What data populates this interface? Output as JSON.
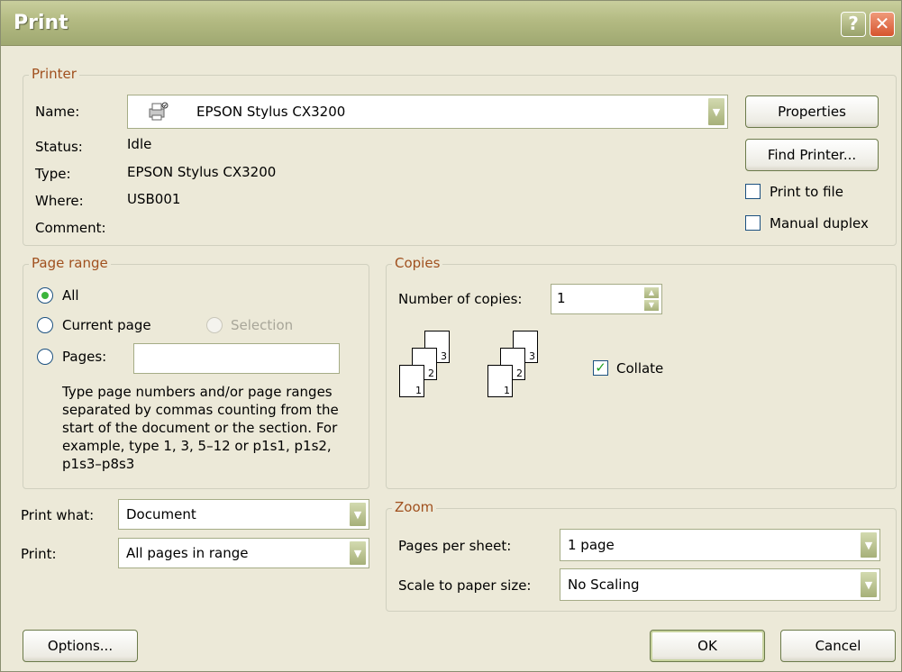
{
  "window": {
    "title": "Print"
  },
  "printer": {
    "group_label": "Printer",
    "name_label": "Name:",
    "name_value": "EPSON Stylus CX3200",
    "status_label": "Status:",
    "status_value": "Idle",
    "type_label": "Type:",
    "type_value": "EPSON Stylus CX3200",
    "where_label": "Where:",
    "where_value": "USB001",
    "comment_label": "Comment:",
    "comment_value": "",
    "properties_button": "Properties",
    "find_printer_button": "Find Printer...",
    "print_to_file_label": "Print to file",
    "print_to_file_checked": false,
    "manual_duplex_label": "Manual duplex",
    "manual_duplex_checked": false
  },
  "page_range": {
    "group_label": "Page range",
    "all_label": "All",
    "current_page_label": "Current page",
    "selection_label": "Selection",
    "pages_label": "Pages:",
    "pages_value": "",
    "selected": "All",
    "help_text": "Type page numbers and/or page ranges separated by commas counting from the start of the document or the section. For example, type 1, 3, 5–12 or p1s1, p1s2, p1s3–p8s3"
  },
  "copies": {
    "group_label": "Copies",
    "number_label": "Number of copies:",
    "number_value": "1",
    "collate_label": "Collate",
    "collate_checked": true,
    "stack_pages": [
      "1",
      "2",
      "3"
    ]
  },
  "print_what": {
    "label": "Print what:",
    "value": "Document"
  },
  "print": {
    "label": "Print:",
    "value": "All pages in range"
  },
  "zoom": {
    "group_label": "Zoom",
    "pages_per_sheet_label": "Pages per sheet:",
    "pages_per_sheet_value": "1 page",
    "scale_label": "Scale to paper size:",
    "scale_value": "No Scaling"
  },
  "footer": {
    "options_button": "Options...",
    "ok_button": "OK",
    "cancel_button": "Cancel"
  },
  "icons": {
    "help": "?",
    "close": "✕",
    "dropdown": "▼",
    "spin_up": "▲",
    "spin_down": "▼",
    "check": "✓"
  }
}
